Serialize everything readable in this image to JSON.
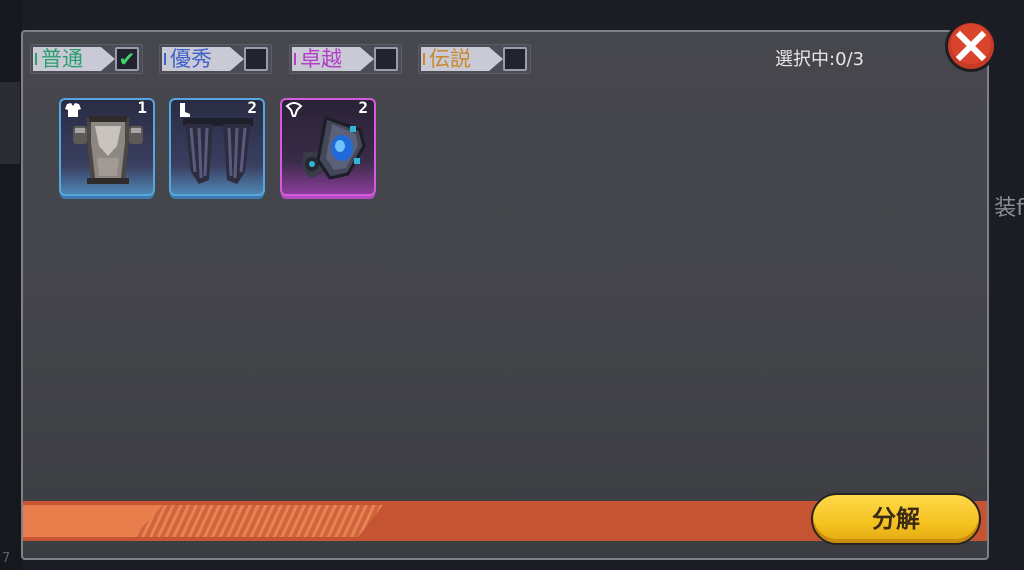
{
  "background": {
    "side_text": "装f",
    "corner_text": "7"
  },
  "filters": [
    {
      "label": "普通",
      "checked": true,
      "color": "#2d9e6e"
    },
    {
      "label": "優秀",
      "checked": false,
      "color": "#3f63c8"
    },
    {
      "label": "卓越",
      "checked": false,
      "color": "#b23fc4"
    },
    {
      "label": "伝説",
      "checked": false,
      "color": "#c9892a"
    }
  ],
  "check_mark": "✔",
  "selection": {
    "text": "選択中:0/3"
  },
  "items": [
    {
      "type": "chest-armor",
      "count": "1",
      "rarity": "rare"
    },
    {
      "type": "leg-armor",
      "count": "2",
      "rarity": "rare"
    },
    {
      "type": "amulet",
      "count": "2",
      "rarity": "epic"
    }
  ],
  "buttons": {
    "decompose": "分解"
  },
  "colors": {
    "accent": "#c55432",
    "button": "#f5c21f",
    "close": "#c73a25"
  }
}
